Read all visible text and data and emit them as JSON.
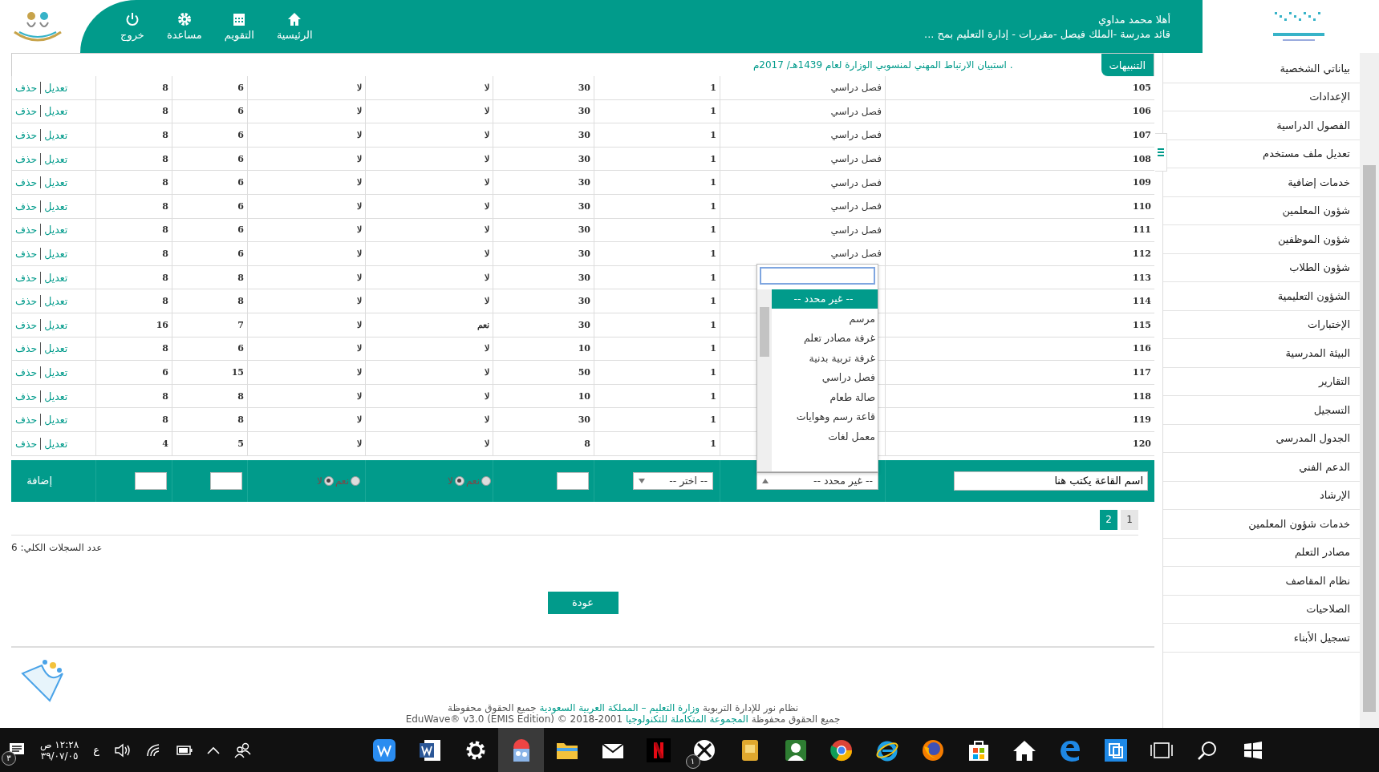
{
  "header": {
    "greeting": "أهلا محمد مداوي",
    "role": "قائد مدرسة -الملك فيصل -مقررات - إدارة التعليم بمح ...",
    "nav": [
      {
        "kind": "home",
        "label": "الرئيسية"
      },
      {
        "kind": "calendar",
        "label": "التقويم"
      },
      {
        "kind": "help",
        "label": "مساعدة"
      },
      {
        "kind": "logout",
        "label": "خروج"
      }
    ]
  },
  "notice": {
    "tab": "التنبيهات",
    "text": ". استبيان الارتباط المهني لمنسوبي الوزارة لعام 1439هـ/ 2017م"
  },
  "table": {
    "rows": [
      {
        "id": "105",
        "type": "فصل دراسي",
        "values": [
          "1",
          "30",
          "لا",
          "لا",
          "6",
          "8"
        ],
        "actions": [
          "تعديل",
          "حذف"
        ]
      },
      {
        "id": "106",
        "type": "فصل دراسي",
        "values": [
          "1",
          "30",
          "لا",
          "لا",
          "6",
          "8"
        ],
        "actions": [
          "تعديل",
          "حذف"
        ]
      },
      {
        "id": "107",
        "type": "فصل دراسي",
        "values": [
          "1",
          "30",
          "لا",
          "لا",
          "6",
          "8"
        ],
        "actions": [
          "تعديل",
          "حذف"
        ]
      },
      {
        "id": "108",
        "type": "فصل دراسي",
        "values": [
          "1",
          "30",
          "لا",
          "لا",
          "6",
          "8"
        ],
        "actions": [
          "تعديل",
          "حذف"
        ]
      },
      {
        "id": "109",
        "type": "فصل دراسي",
        "values": [
          "1",
          "30",
          "لا",
          "لا",
          "6",
          "8"
        ],
        "actions": [
          "تعديل",
          "حذف"
        ]
      },
      {
        "id": "110",
        "type": "فصل دراسي",
        "values": [
          "1",
          "30",
          "لا",
          "لا",
          "6",
          "8"
        ],
        "actions": [
          "تعديل",
          "حذف"
        ]
      },
      {
        "id": "111",
        "type": "فصل دراسي",
        "values": [
          "1",
          "30",
          "لا",
          "لا",
          "6",
          "8"
        ],
        "actions": [
          "تعديل",
          "حذف"
        ]
      },
      {
        "id": "112",
        "type": "فصل دراسي",
        "values": [
          "1",
          "30",
          "لا",
          "لا",
          "6",
          "8"
        ],
        "actions": [
          "تعديل",
          "حذف"
        ]
      },
      {
        "id": "113",
        "values": [
          "1",
          "30",
          "لا",
          "لا",
          "8",
          "8"
        ],
        "actions": [
          "تعديل",
          "حذف"
        ]
      },
      {
        "id": "114",
        "values": [
          "1",
          "30",
          "لا",
          "لا",
          "8",
          "8"
        ],
        "actions": [
          "تعديل",
          "حذف"
        ]
      },
      {
        "id": "115",
        "values": [
          "1",
          "30",
          "نعم",
          "لا",
          "7",
          "16"
        ],
        "actions": [
          "تعديل",
          "حذف"
        ]
      },
      {
        "id": "116",
        "values": [
          "1",
          "10",
          "لا",
          "لا",
          "6",
          "8"
        ],
        "actions": [
          "تعديل",
          "حذف"
        ]
      },
      {
        "id": "117",
        "values": [
          "1",
          "50",
          "لا",
          "لا",
          "15",
          "6"
        ],
        "actions": [
          "تعديل",
          "حذف"
        ]
      },
      {
        "id": "118",
        "values": [
          "1",
          "10",
          "لا",
          "لا",
          "8",
          "8"
        ],
        "actions": [
          "تعديل",
          "حذف"
        ]
      },
      {
        "id": "119",
        "values": [
          "1",
          "30",
          "لا",
          "لا",
          "8",
          "8"
        ],
        "actions": [
          "تعديل",
          "حذف"
        ]
      },
      {
        "id": "120",
        "values": [
          "1",
          "8",
          "لا",
          "لا",
          "5",
          "4"
        ],
        "actions": [
          "تعديل",
          "حذف"
        ]
      }
    ]
  },
  "add_row": {
    "name": {
      "value": "اسم القاعة يكتب هنا"
    },
    "type_select": {
      "value": "-- غير محدد --",
      "expanded": true
    },
    "choose_select": {
      "value": "-- اختر --"
    },
    "radio_groups": [
      [
        {
          "label": "نعم",
          "selected": false
        },
        {
          "label": "لا",
          "selected": true
        }
      ],
      [
        {
          "label": "نعم",
          "selected": false
        },
        {
          "label": "لا",
          "selected": true
        }
      ]
    ],
    "add": "إضافة"
  },
  "dropdown": {
    "options": [
      {
        "label": "-- غير محدد --",
        "selected": true
      },
      {
        "label": "مرسم",
        "selected": false
      },
      {
        "label": "غرفة مصادر تعلم",
        "selected": false
      },
      {
        "label": "غرفة تربية بدنية",
        "selected": false
      },
      {
        "label": "فصل دراسي",
        "selected": false
      },
      {
        "label": "صالة طعام",
        "selected": false
      },
      {
        "label": "قاعة رسم وهوايات",
        "selected": false
      },
      {
        "label": "معمل لغات",
        "selected": false
      }
    ]
  },
  "pagination": [
    {
      "label": "1",
      "selected": false
    },
    {
      "label": "2",
      "selected": true
    }
  ],
  "record_count": "عدد السجلات الكلي: 6",
  "back": "عودة",
  "footer": [
    [
      {
        "text": "نظام نور للإدارة التربوية ",
        "link": false
      },
      {
        "text": "وزارة التعليم – المملكة العربية السعودية",
        "link": true
      },
      {
        "text": " جميع الحقوق محفوظة",
        "link": false
      }
    ],
    [
      {
        "text": "جميع الحقوق محفوظة ",
        "link": false
      },
      {
        "text": "المجموعة المتكاملة للتكنولوجيا",
        "link": true
      },
      {
        "text": " 2001-2018 © EduWave® v3.0 (EMIS Edition)",
        "link": false
      }
    ]
  ],
  "sidebar": {
    "items": [
      "بياناتي الشخصية",
      "الإعدادات",
      "الفصول الدراسية",
      "تعديل ملف مستخدم",
      "خدمات إضافية",
      "شؤون المعلمين",
      "شؤون الموظفين",
      "شؤون الطلاب",
      "الشؤون التعليمية",
      "الإختبارات",
      "البيئة المدرسية",
      "التقارير",
      "التسجيل",
      "الجدول المدرسي",
      "الدعم الفني",
      "الإرشاد",
      "خدمات شؤون المعلمين",
      "مصادر التعلم",
      "نظام المقاصف",
      "الصلاحيات",
      "تسجيل الأبناء"
    ]
  },
  "taskbar": {
    "notification_badge": "٣",
    "time": "١٢:٢٨ ص",
    "date": "٣٩/٠٧/٠٥",
    "language": "ع",
    "apps": [
      {
        "kind": "wps",
        "selected": false
      },
      {
        "kind": "word",
        "selected": false
      },
      {
        "kind": "settings",
        "selected": false
      },
      {
        "kind": "photos",
        "selected": true
      },
      {
        "kind": "folder",
        "selected": false
      },
      {
        "kind": "mail",
        "selected": false
      },
      {
        "kind": "streaming",
        "selected": false
      },
      {
        "kind": "xbox",
        "selected": false,
        "badge": "١"
      },
      {
        "kind": "notes",
        "selected": false
      },
      {
        "kind": "contacts",
        "selected": false
      },
      {
        "kind": "chrome",
        "selected": false
      },
      {
        "kind": "ie",
        "selected": false
      },
      {
        "kind": "firefox",
        "selected": false
      },
      {
        "kind": "store",
        "selected": false
      },
      {
        "kind": "home",
        "selected": false
      },
      {
        "kind": "edge",
        "selected": false
      },
      {
        "kind": "tile",
        "selected": false
      },
      {
        "kind": "tablet",
        "selected": false
      },
      {
        "kind": "search",
        "selected": false
      },
      {
        "kind": "windows",
        "selected": false
      }
    ]
  }
}
